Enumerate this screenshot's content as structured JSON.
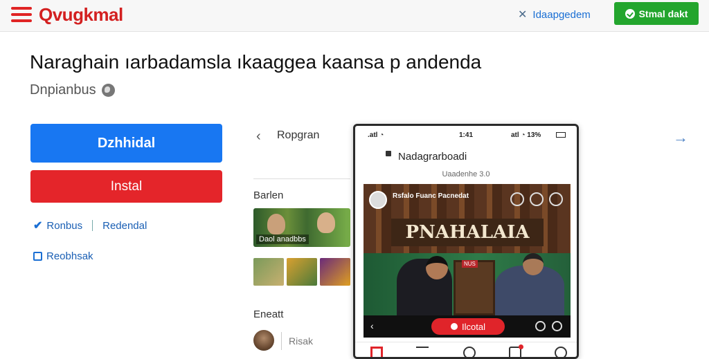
{
  "header": {
    "logo_text": "Qvugkmal",
    "link_text": "Idaapgedem",
    "action_button": "Stmal dakt"
  },
  "page": {
    "title": "Naraghain ıarbadamsla ıkaaggea kaansa p andenda",
    "subtitle": "Dnpianbus"
  },
  "actions": {
    "primary_button": "Dzhhidal",
    "install_button": "Instal",
    "option1_label": "Ronbus",
    "option1_link": "Redendal",
    "option2_label": "Reobhsak"
  },
  "panel": {
    "nav_title": "Ropgran",
    "section1_label": "Barlen",
    "thumb_caption": "Daol anadbbs",
    "section2_label": "Eneatt",
    "comment_placeholder": "Risak"
  },
  "phone": {
    "status_left": ".atl ◔",
    "status_center": "1:41",
    "status_right": "atl ◔ 13%",
    "title": "Nadagrarboadi",
    "subtitle": "Uaadenhe 3.0",
    "channel_name": "Rsfalo Fuanc Pacnedat",
    "banner_text": "PNAHALAIA",
    "tag_text": "NUS",
    "live_button": "Ilcotal"
  },
  "colors": {
    "brand_red": "#e4252a",
    "primary_blue": "#1877f2",
    "success_green": "#23a52d",
    "link_blue": "#1a6fd4"
  },
  "icons": [
    "menu-icon",
    "close-icon",
    "check-icon",
    "globe-icon",
    "checkbox-icon",
    "chevron-left-icon",
    "arrow-right-icon",
    "home-icon",
    "record-icon",
    "profile-icon"
  ]
}
